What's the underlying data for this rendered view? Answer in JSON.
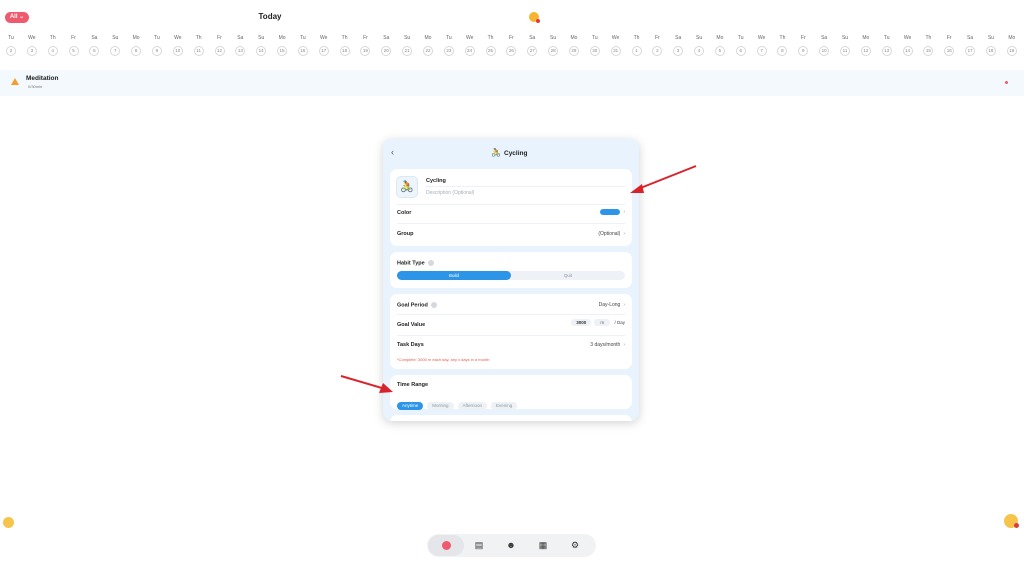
{
  "header": {
    "filter_label": "All ⌄",
    "title": "Today"
  },
  "calendar": [
    {
      "wd": "Tu",
      "d": "2"
    },
    {
      "wd": "We",
      "d": "3"
    },
    {
      "wd": "Th",
      "d": "4"
    },
    {
      "wd": "Fr",
      "d": "5"
    },
    {
      "wd": "Sa",
      "d": "6"
    },
    {
      "wd": "Su",
      "d": "7"
    },
    {
      "wd": "Mo",
      "d": "8"
    },
    {
      "wd": "Tu",
      "d": "9"
    },
    {
      "wd": "We",
      "d": "10"
    },
    {
      "wd": "Th",
      "d": "11"
    },
    {
      "wd": "Fr",
      "d": "12"
    },
    {
      "wd": "Sa",
      "d": "13"
    },
    {
      "wd": "Su",
      "d": "14"
    },
    {
      "wd": "Mo",
      "d": "15"
    },
    {
      "wd": "Tu",
      "d": "16"
    },
    {
      "wd": "We",
      "d": "17"
    },
    {
      "wd": "Th",
      "d": "18"
    },
    {
      "wd": "Fr",
      "d": "19"
    },
    {
      "wd": "Sa",
      "d": "20"
    },
    {
      "wd": "Su",
      "d": "21"
    },
    {
      "wd": "Mo",
      "d": "22"
    },
    {
      "wd": "Tu",
      "d": "23"
    },
    {
      "wd": "We",
      "d": "24"
    },
    {
      "wd": "Th",
      "d": "25"
    },
    {
      "wd": "Fr",
      "d": "26"
    },
    {
      "wd": "Sa",
      "d": "27"
    },
    {
      "wd": "Su",
      "d": "28"
    },
    {
      "wd": "Mo",
      "d": "29"
    },
    {
      "wd": "Tu",
      "d": "30"
    },
    {
      "wd": "We",
      "d": "31"
    },
    {
      "wd": "Th",
      "d": "1"
    },
    {
      "wd": "Fr",
      "d": "2"
    },
    {
      "wd": "Sa",
      "d": "3"
    },
    {
      "wd": "Su",
      "d": "4"
    },
    {
      "wd": "Mo",
      "d": "5"
    },
    {
      "wd": "Tu",
      "d": "6"
    },
    {
      "wd": "We",
      "d": "7"
    },
    {
      "wd": "Th",
      "d": "8"
    },
    {
      "wd": "Fr",
      "d": "9"
    },
    {
      "wd": "Sa",
      "d": "10"
    },
    {
      "wd": "Su",
      "d": "11"
    },
    {
      "wd": "Mo",
      "d": "12"
    },
    {
      "wd": "Tu",
      "d": "13"
    },
    {
      "wd": "We",
      "d": "14"
    },
    {
      "wd": "Th",
      "d": "15"
    },
    {
      "wd": "Fr",
      "d": "16"
    },
    {
      "wd": "Sa",
      "d": "17"
    },
    {
      "wd": "Su",
      "d": "18"
    },
    {
      "wd": "Mo",
      "d": "19"
    }
  ],
  "habit": {
    "name": "Meditation",
    "progress": "0/30min"
  },
  "modal": {
    "back_icon": "chevron-left-icon",
    "title_icon": "cyclist-icon",
    "title": "Cycling",
    "name": "Cycling",
    "description_placeholder": "Description (Optional)",
    "color_label": "Color",
    "color_value": "#2d95e8",
    "group_label": "Group",
    "group_value": "(Optional)",
    "habit_type_label": "Habit Type",
    "habit_type_options": [
      "Build",
      "Quit"
    ],
    "habit_type_selected": "Build",
    "goal_period_label": "Goal Period",
    "goal_period_value": "Day-Long",
    "goal_value_label": "Goal Value",
    "goal_value": "3000",
    "goal_unit": "m",
    "goal_per": "/ Day",
    "task_days_label": "Task Days",
    "task_days_value": "3 days/month",
    "task_days_hint": "*Complete: 3000 m each day, any x days in a month",
    "time_range_label": "Time Range",
    "time_range_options": [
      "Anytime",
      "Morning",
      "Afternoon",
      "Evening"
    ],
    "time_range_selected": "Anytime"
  },
  "colors": {
    "accent": "#2d95e8",
    "brand_pink": "#f05a6e",
    "annotation_arrow": "#d9232a"
  },
  "nav": [
    "today-icon",
    "notes-icon",
    "people-icon",
    "report-icon",
    "settings-icon"
  ]
}
